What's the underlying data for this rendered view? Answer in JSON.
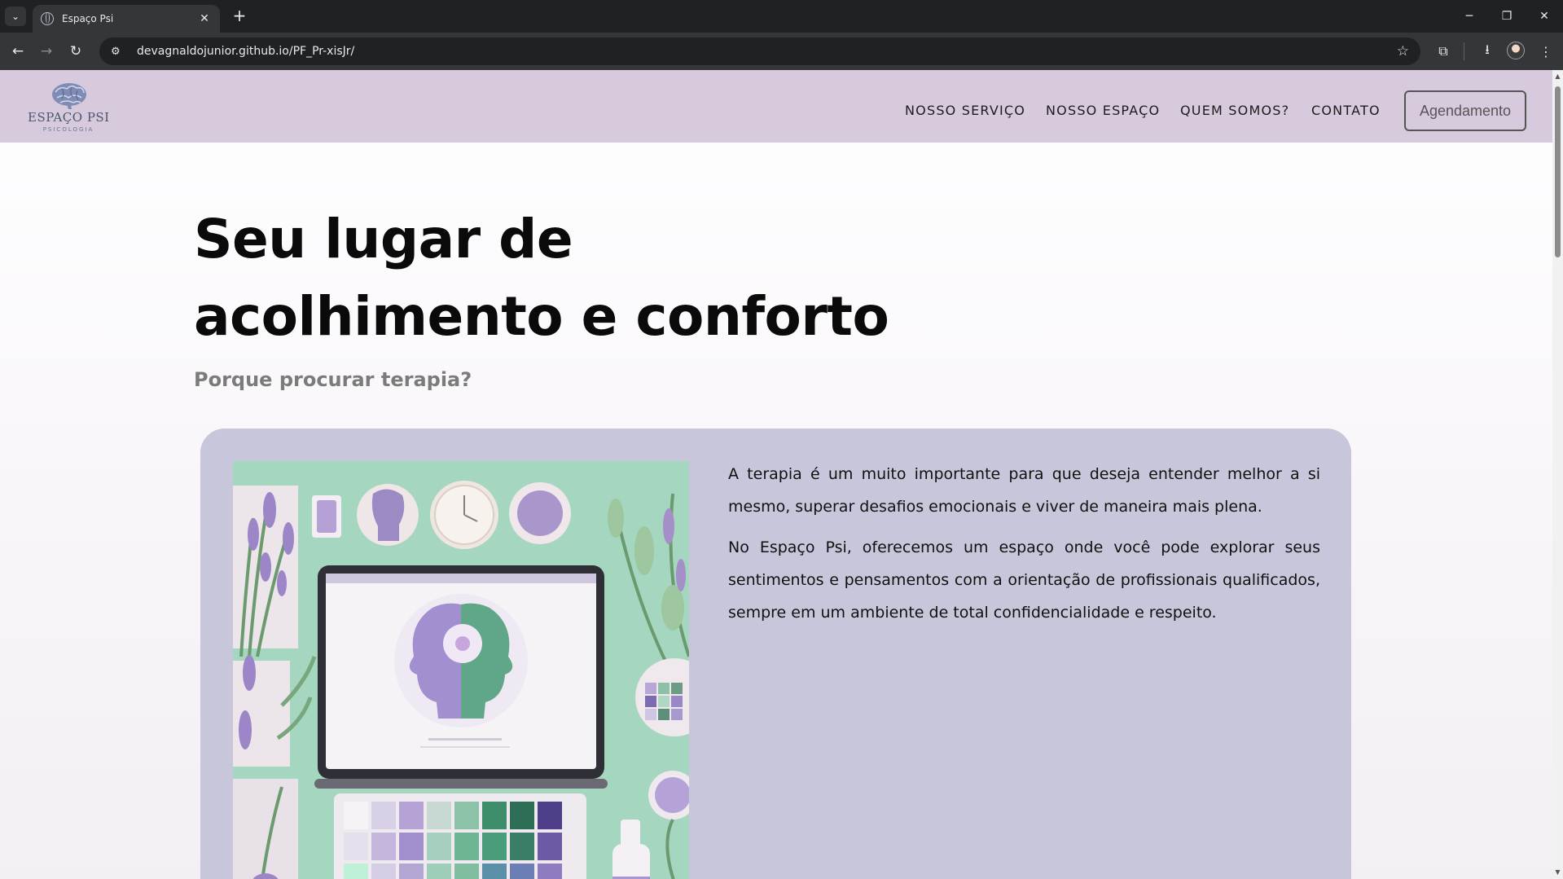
{
  "browser": {
    "tab_title": "Espaço Psi",
    "url": "devagnaldojunior.github.io/PF_Pr-xisJr/"
  },
  "site": {
    "logo": {
      "name": "ESPAÇO PSI",
      "tagline": "PSICOLOGIA"
    },
    "nav": [
      {
        "label": "NOSSO SERVIÇO"
      },
      {
        "label": "NOSSO ESPAÇO"
      },
      {
        "label": "QUEM SOMOS?"
      },
      {
        "label": "CONTATO"
      }
    ],
    "cta_label": "Agendamento",
    "hero": {
      "title": "Seu lugar de\nacolhimento e conforto",
      "subtitle": "Porque procurar terapia?"
    },
    "card": {
      "paragraphs": [
        "A terapia é um muito importante para que deseja entender melhor a si mesmo, superar desafios emocionais e viver de maneira mais plena.",
        "No Espaço Psi, oferecemos um espaço onde você pode explorar seus sentimentos e pensamentos com a orientação de profissionais qualificados, sempre em um ambiente de total confidencialidade e respeito."
      ]
    }
  },
  "colors": {
    "header_bg": "#d8cadd",
    "card_bg": "#c7c6da",
    "accent_green": "#9ed2ba",
    "accent_purple": "#a48fc8"
  },
  "icons": {
    "tab_search": "chevron-down-icon",
    "favicon": "globe-icon",
    "site_info": "tune-icon",
    "bookmark": "star-icon",
    "extensions": "puzzle-icon",
    "downloads": "download-icon",
    "menu": "kebab-icon"
  }
}
